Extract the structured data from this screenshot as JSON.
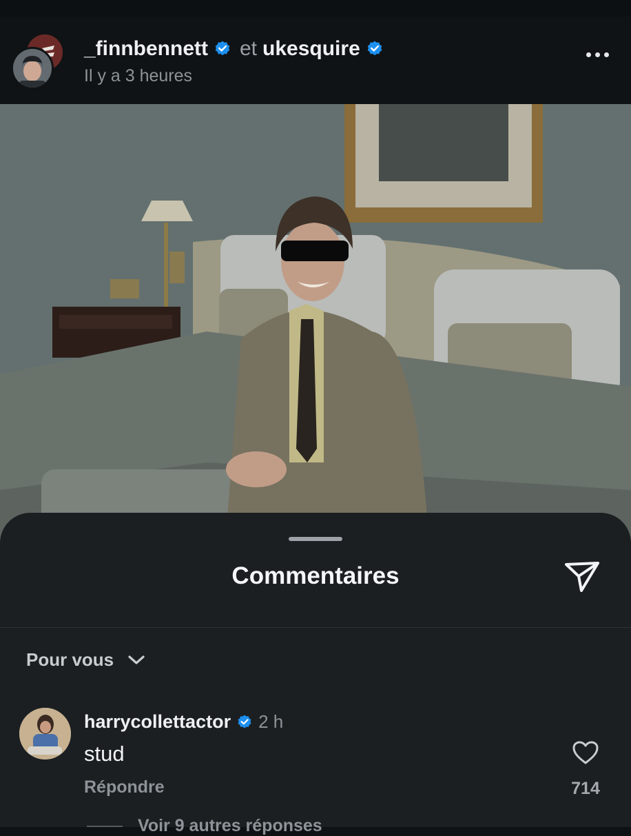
{
  "post": {
    "author": "_finnbennett",
    "connector": "et",
    "coauthor": "ukesquire",
    "time": "Il y a 3 heures",
    "more_icon": "more-horizontal-icon",
    "author_verified": true,
    "coauthor_verified": true
  },
  "photo": {
    "alt_subject": "man in checked suit and sunglasses seated on a bed"
  },
  "comments_sheet": {
    "title": "Commentaires",
    "share_icon": "send-icon",
    "filter_label": "Pour vous",
    "filter_icon": "chevron-down-icon"
  },
  "comments": [
    {
      "username": "harrycollettactor",
      "verified": true,
      "time": "2 h",
      "text": "stud",
      "reply_label": "Répondre",
      "likes": "714",
      "more_replies": "Voir 9 autres réponses"
    }
  ],
  "colors": {
    "verified_badge": "#1d8ff0",
    "background": "#0f1214",
    "sheet": "#1b1f22"
  }
}
